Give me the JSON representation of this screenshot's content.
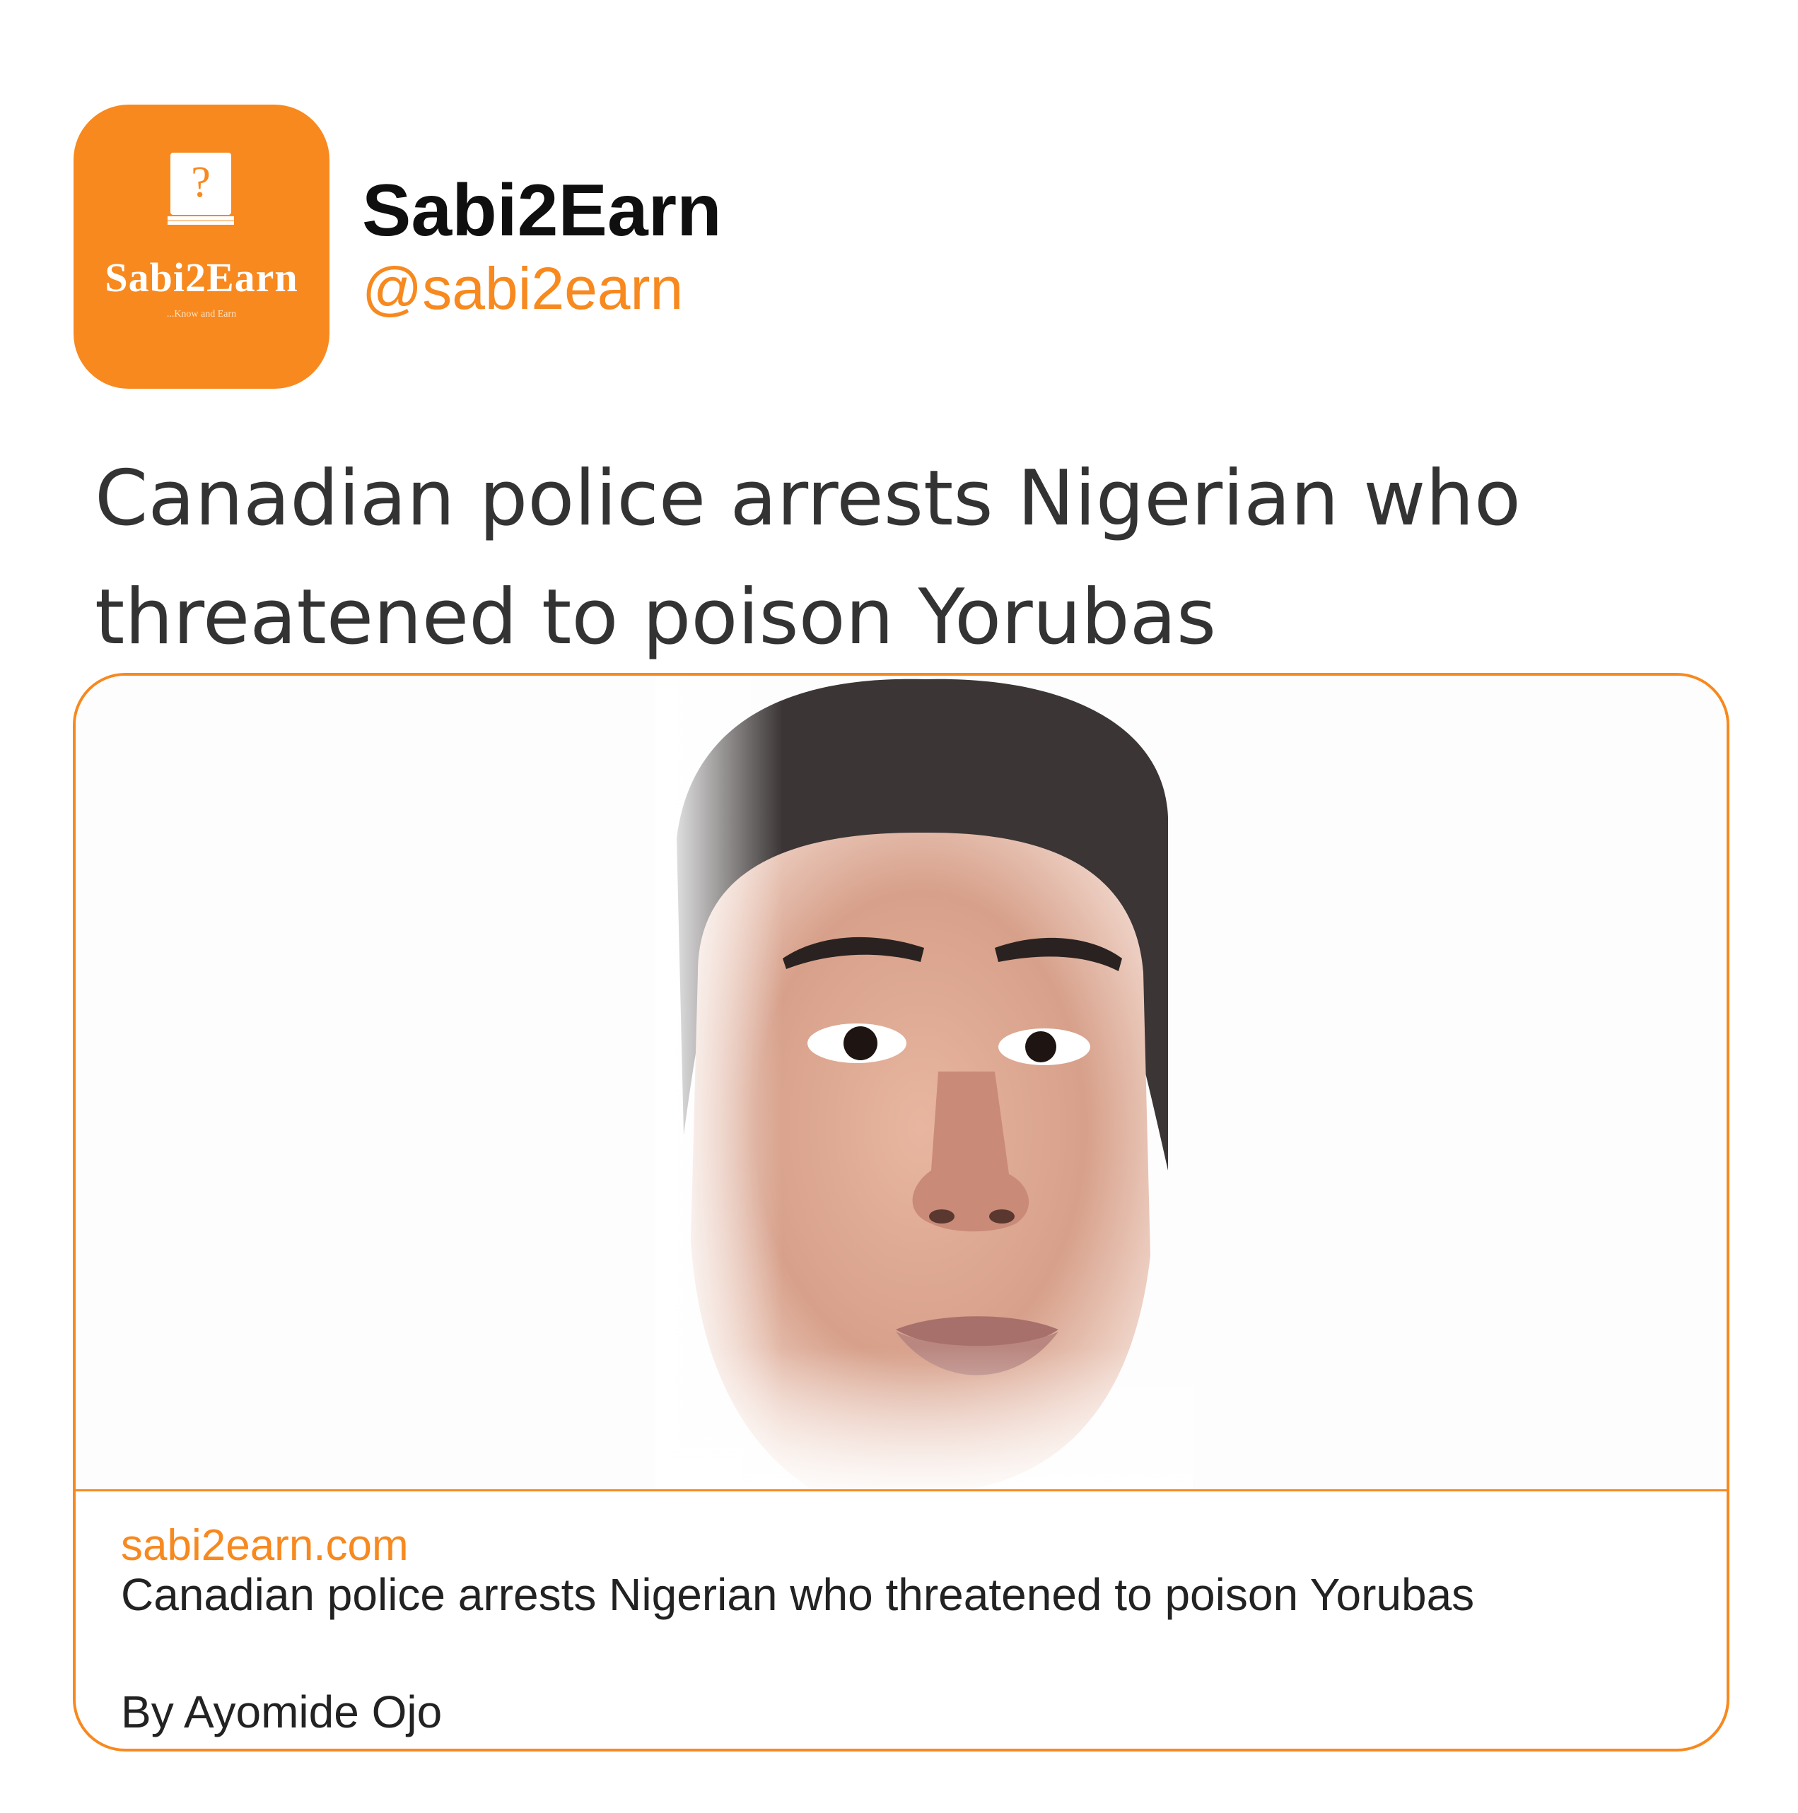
{
  "account": {
    "avatar": {
      "logo_text": "Sabi2Earn",
      "logo_tagline": "...Know and Earn",
      "icon": "question-book-icon"
    },
    "name": "Sabi2Earn",
    "handle": "@sabi2earn"
  },
  "tweet": {
    "text": "Canadian police arrests Nigerian who threatened to poison Yorubas"
  },
  "link_card": {
    "image": "portrait-photo",
    "domain": "sabi2earn.com",
    "title": "Canadian police arrests Nigerian who threatened to poison Yorubas",
    "description": "By Ayomide Ojo"
  },
  "colors": {
    "brand_orange": "#f7891f",
    "text_dark": "#0f0f0f",
    "text_body": "#333333"
  }
}
